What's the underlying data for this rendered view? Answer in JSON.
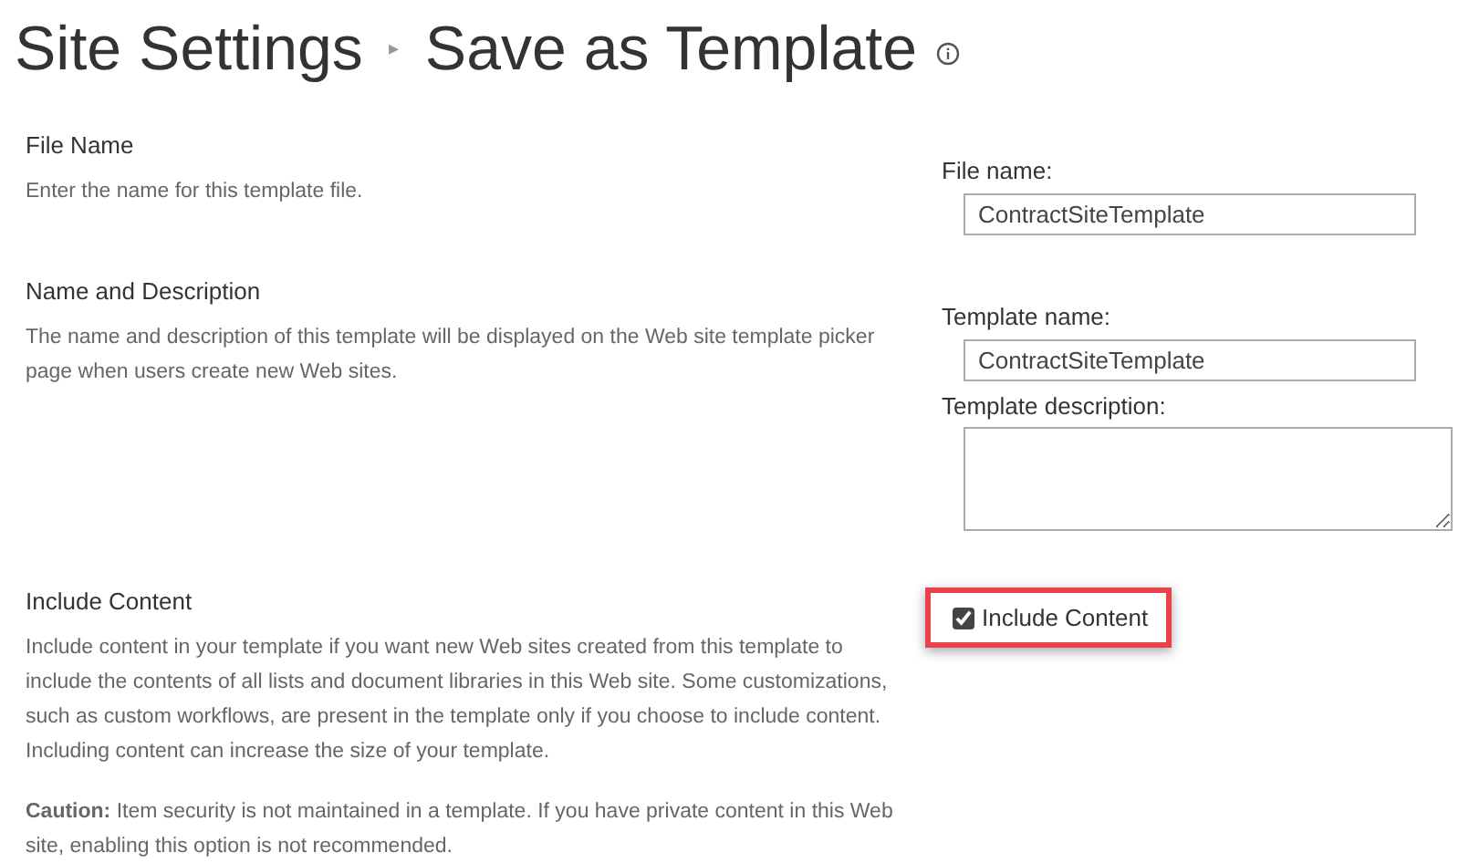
{
  "breadcrumb": {
    "parent": "Site Settings",
    "separator": "▸",
    "current": "Save as Template"
  },
  "sections": [
    {
      "kind": "text_field",
      "title": "File Name",
      "description": "Enter the name for this template file.",
      "fields": [
        {
          "kind": "input",
          "label": "File name:",
          "value": "ContractSiteTemplate"
        }
      ]
    },
    {
      "kind": "text_field",
      "title": "Name and Description",
      "description": "The name and description of this template will be displayed on the Web site template picker page when users create new Web sites.",
      "fields": [
        {
          "kind": "input",
          "label": "Template name:",
          "value": "ContractSiteTemplate"
        },
        {
          "kind": "textarea",
          "label": "Template description:"
        }
      ]
    },
    {
      "kind": "checkbox",
      "title": "Include Content",
      "description": "Include content in your template if you want new Web sites created from this template to include the contents of all lists and document libraries in this Web site. Some customizations, such as custom workflows, are present in the template only if you choose to include content. Including content can increase the size of your template.",
      "note": "**Caution:** Item security is not maintained in a template. If you have private content in this Web site, enabling this option is not recommended.",
      "checkbox": {
        "label": "Include Content",
        "checked": true,
        "highlighted": true
      }
    }
  ]
}
